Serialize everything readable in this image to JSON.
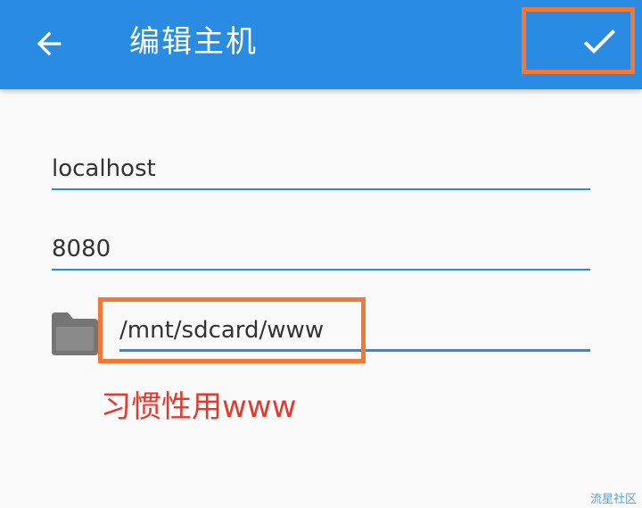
{
  "appbar": {
    "title": "编辑主机",
    "back_icon": "arrow-left-icon",
    "confirm_icon": "check-icon",
    "bg_color": "#2a8be3"
  },
  "form": {
    "host_value": "localhost",
    "port_value": "8080",
    "path_value": "/mnt/sdcard/www",
    "folder_icon": "folder-icon"
  },
  "annotation": {
    "note": "习惯性用www",
    "highlight_color": "#f47833",
    "note_color": "#e43a2e"
  },
  "watermark": "流星社区"
}
